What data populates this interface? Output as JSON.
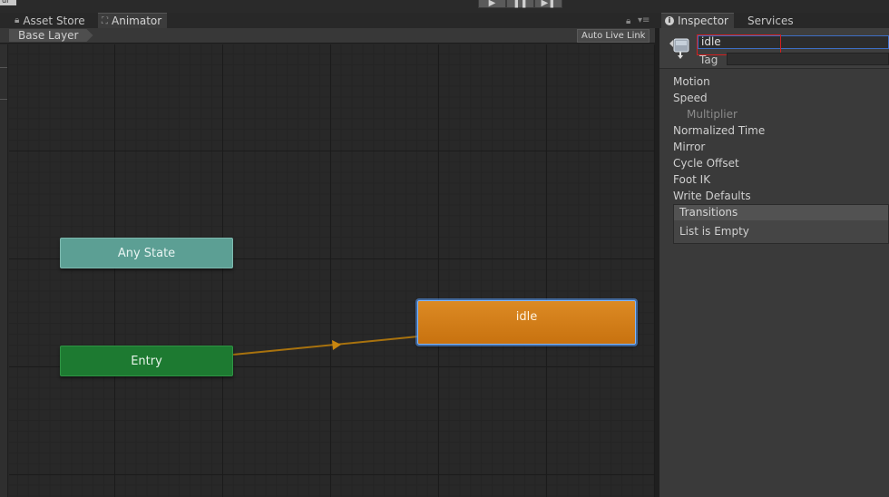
{
  "top": {
    "corner_text": "ul"
  },
  "playback": {
    "play_icon": "play-icon",
    "pause_icon": "pause-icon",
    "step_icon": "step-icon",
    "play": "▶",
    "pause": "❚❚",
    "step": "▶❚"
  },
  "tabs": {
    "asset_store": "Asset Store",
    "animator": "Animator",
    "inspector": "Inspector",
    "services": "Services"
  },
  "animator": {
    "breadcrumb": "Base Layer",
    "auto_live_link": "Auto Live Link",
    "states": {
      "any_state": "Any State",
      "entry": "Entry",
      "idle": "idle"
    },
    "colors": {
      "any_state": "#5c9f94",
      "entry": "#1d7a31",
      "idle": "#d07c18",
      "transition": "#a8720e"
    }
  },
  "inspector": {
    "name_value": "idle",
    "tag_label": "Tag",
    "properties": [
      "Motion",
      "Speed",
      "Multiplier",
      "Normalized Time",
      "Mirror",
      "Cycle Offset",
      "Foot IK",
      "Write Defaults"
    ],
    "transitions_header": "Transitions",
    "transitions_empty": "List is Empty"
  }
}
